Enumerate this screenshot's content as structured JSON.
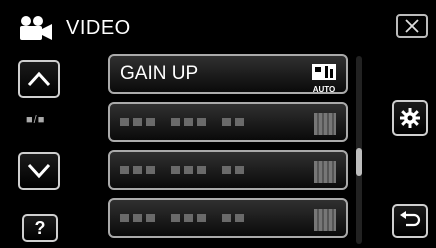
{
  "header": {
    "title": "VIDEO",
    "icon": "video-camera-icon"
  },
  "close": {
    "icon": "close-icon"
  },
  "left_panel": {
    "page_indicator": "■/■",
    "up_icon": "chevron-up-icon",
    "down_icon": "chevron-down-icon",
    "help_label": "?"
  },
  "menu": {
    "items": [
      {
        "label": "GAIN UP",
        "icon": "gain-up-auto-icon",
        "icon_text": "AUTO"
      }
    ]
  },
  "right_panel": {
    "settings_icon": "gear-icon",
    "back_icon": "return-icon"
  }
}
